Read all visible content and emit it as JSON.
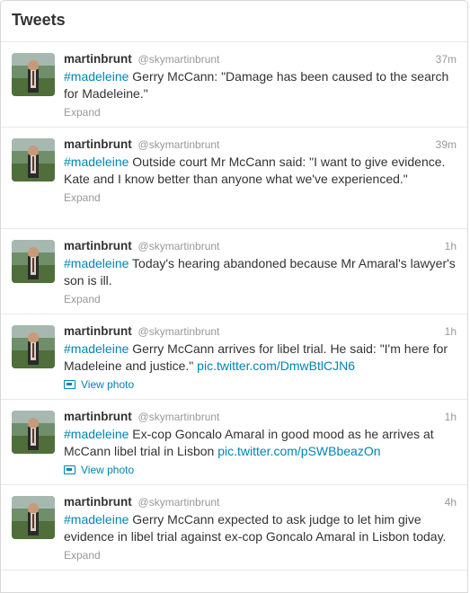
{
  "header": {
    "title": "Tweets"
  },
  "tweets": [
    {
      "name": "martinbrunt",
      "handle": "@skymartinbrunt",
      "time": "37m",
      "hashtag": "#madeleine",
      "text": " Gerry McCann: \"Damage has been caused to the search for Madeleine.\"",
      "link": "",
      "action": "Expand"
    },
    {
      "name": "martinbrunt",
      "handle": "@skymartinbrunt",
      "time": "39m",
      "hashtag": "#madeleine",
      "text": " Outside court Mr McCann said: \"I want to give evidence. Kate and I know better than anyone what we've experienced.\"",
      "link": "",
      "action": "Expand"
    },
    {
      "name": "martinbrunt",
      "handle": "@skymartinbrunt",
      "time": "1h",
      "hashtag": "#madeleine",
      "text": " Today's hearing abandoned because Mr Amaral's lawyer's son is ill.",
      "link": "",
      "action": "Expand"
    },
    {
      "name": "martinbrunt",
      "handle": "@skymartinbrunt",
      "time": "1h",
      "hashtag": "#madeleine",
      "text": " Gerry McCann arrives for libel trial. He said: \"I'm here for Madeleine and justice.\" ",
      "link": "pic.twitter.com/DmwBtlCJN6",
      "action": "View photo"
    },
    {
      "name": "martinbrunt",
      "handle": "@skymartinbrunt",
      "time": "1h",
      "hashtag": "#madeleine",
      "text": " Ex-cop Goncalo Amaral in good mood as he arrives at McCann libel trial in Lisbon ",
      "link": "pic.twitter.com/pSWBbeazOn",
      "action": "View photo"
    },
    {
      "name": "martinbrunt",
      "handle": "@skymartinbrunt",
      "time": "4h",
      "hashtag": "#madeleine",
      "text": " Gerry McCann expected to ask judge to let him give evidence in libel trial against ex-cop Goncalo Amaral in Lisbon today.",
      "link": "",
      "action": "Expand"
    }
  ],
  "colors": {
    "link": "#0084b4",
    "muted": "#999999",
    "text": "#333333",
    "border": "#e8e8e8"
  },
  "icons": {
    "avatar": "avatar-image",
    "photo": "photo-icon"
  }
}
